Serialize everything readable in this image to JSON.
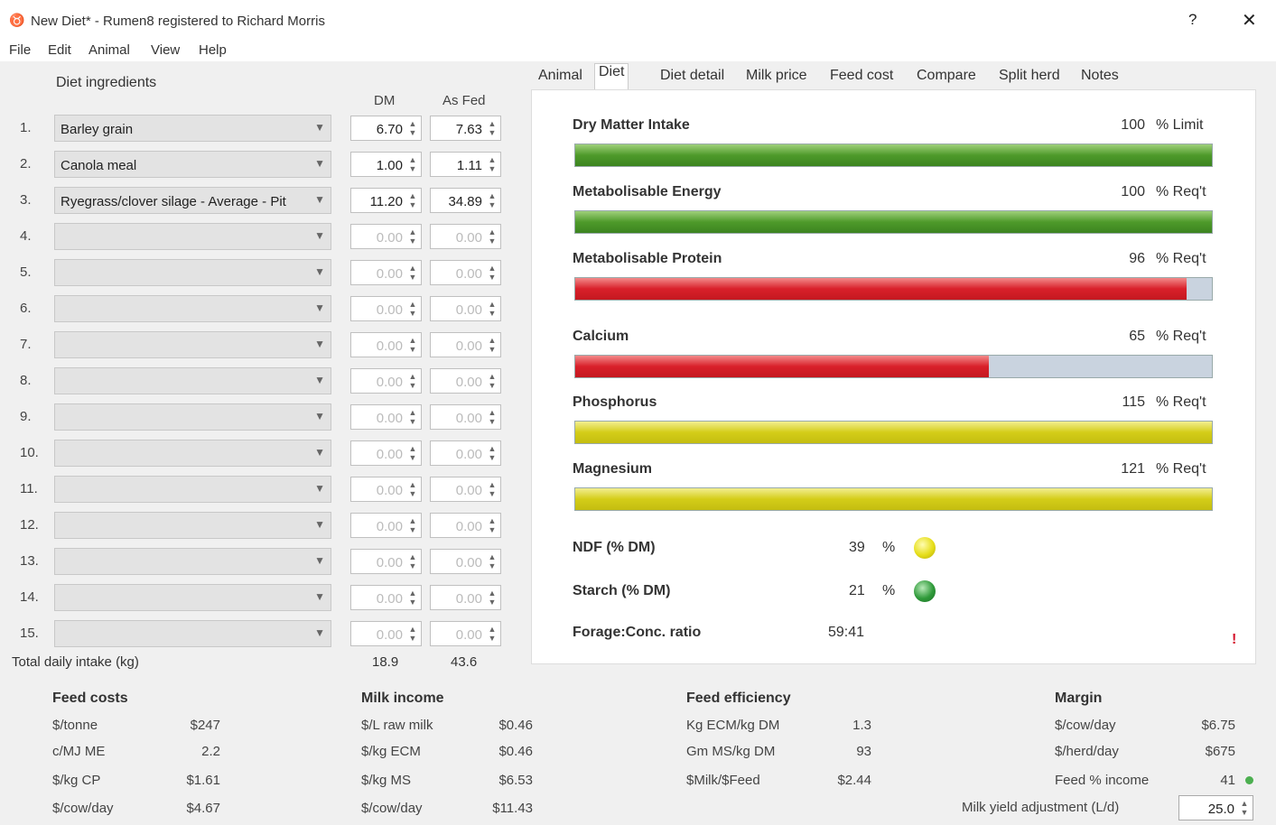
{
  "window": {
    "title": "New Diet* - Rumen8 registered to Richard Morris",
    "help": "?",
    "close": "✕"
  },
  "menu": [
    "File",
    "Edit",
    "Animal",
    "View",
    "Help"
  ],
  "ingredients": {
    "heading": "Diet ingredients",
    "dm_header": "DM",
    "asfed_header": "As Fed",
    "rows": [
      {
        "num": "1.",
        "name": "Barley grain",
        "dm": "6.70",
        "asfed": "7.63"
      },
      {
        "num": "2.",
        "name": "Canola meal",
        "dm": "1.00",
        "asfed": "1.11"
      },
      {
        "num": "3.",
        "name": "Ryegrass/clover silage - Average - Pit",
        "dm": "11.20",
        "asfed": "34.89"
      },
      {
        "num": "4.",
        "name": "",
        "dm": "0.00",
        "asfed": "0.00"
      },
      {
        "num": "5.",
        "name": "",
        "dm": "0.00",
        "asfed": "0.00"
      },
      {
        "num": "6.",
        "name": "",
        "dm": "0.00",
        "asfed": "0.00"
      },
      {
        "num": "7.",
        "name": "",
        "dm": "0.00",
        "asfed": "0.00"
      },
      {
        "num": "8.",
        "name": "",
        "dm": "0.00",
        "asfed": "0.00"
      },
      {
        "num": "9.",
        "name": "",
        "dm": "0.00",
        "asfed": "0.00"
      },
      {
        "num": "10.",
        "name": "",
        "dm": "0.00",
        "asfed": "0.00"
      },
      {
        "num": "11.",
        "name": "",
        "dm": "0.00",
        "asfed": "0.00"
      },
      {
        "num": "12.",
        "name": "",
        "dm": "0.00",
        "asfed": "0.00"
      },
      {
        "num": "13.",
        "name": "",
        "dm": "0.00",
        "asfed": "0.00"
      },
      {
        "num": "14.",
        "name": "",
        "dm": "0.00",
        "asfed": "0.00"
      },
      {
        "num": "15.",
        "name": "",
        "dm": "0.00",
        "asfed": "0.00"
      }
    ],
    "total_label": "Total daily intake (kg)",
    "total_dm": "18.9",
    "total_asfed": "43.6"
  },
  "tabs": [
    "Animal",
    "Diet",
    "Diet detail",
    "Milk price",
    "Feed cost",
    "Compare",
    "Split herd",
    "Notes"
  ],
  "active_tab": "Diet",
  "nutrients": [
    {
      "label": "Dry Matter Intake",
      "value": "100",
      "unit": "% Limit",
      "fill": 1.0,
      "color": "green"
    },
    {
      "label": "Metabolisable Energy",
      "value": "100",
      "unit": "% Req't",
      "fill": 1.0,
      "color": "green"
    },
    {
      "label": "Metabolisable Protein",
      "value": "96",
      "unit": "% Req't",
      "fill": 0.96,
      "color": "red"
    },
    {
      "label": "Calcium",
      "value": "65",
      "unit": "% Req't",
      "fill": 0.65,
      "color": "red"
    },
    {
      "label": "Phosphorus",
      "value": "115",
      "unit": "% Req't",
      "fill": 1.0,
      "color": "yellow"
    },
    {
      "label": "Magnesium",
      "value": "121",
      "unit": "% Req't",
      "fill": 1.0,
      "color": "yellow"
    }
  ],
  "indicators": [
    {
      "label": "NDF (% DM)",
      "value": "39",
      "unit": "%",
      "dot": "yellow"
    },
    {
      "label": "Starch (% DM)",
      "value": "21",
      "unit": "%",
      "dot": "green"
    },
    {
      "label": "Forage:Conc. ratio",
      "value": "59:41"
    }
  ],
  "warning": "!",
  "summary": {
    "feed_costs": {
      "title": "Feed costs",
      "items": [
        [
          "$/tonne",
          "$247"
        ],
        [
          "c/MJ ME",
          "2.2"
        ],
        [
          "$/kg CP",
          "$1.61"
        ],
        [
          "$/cow/day",
          "$4.67"
        ]
      ]
    },
    "milk_income": {
      "title": "Milk income",
      "items": [
        [
          "$/L raw milk",
          "$0.46"
        ],
        [
          "$/kg ECM",
          "$0.46"
        ],
        [
          "$/kg MS",
          "$6.53"
        ],
        [
          "$/cow/day",
          "$11.43"
        ]
      ]
    },
    "feed_efficiency": {
      "title": "Feed efficiency",
      "items": [
        [
          "Kg ECM/kg DM",
          "1.3"
        ],
        [
          "Gm MS/kg DM",
          "93"
        ],
        [
          "$Milk/$Feed",
          "$2.44"
        ]
      ]
    },
    "margin": {
      "title": "Margin",
      "items": [
        [
          "$/cow/day",
          "$6.75"
        ],
        [
          "$/herd/day",
          "$675"
        ],
        [
          "Feed % income",
          "41"
        ]
      ]
    },
    "milk_yield_label": "Milk yield adjustment (L/d)",
    "milk_yield_value": "25.0"
  }
}
